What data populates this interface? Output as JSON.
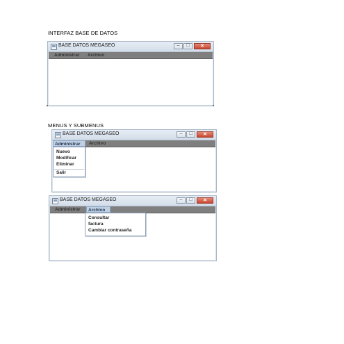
{
  "headings": {
    "interfaz": "INTERFAZ BASE DE DATOS",
    "menus": "MENUS Y SUBMENUS"
  },
  "windows": [
    {
      "title": "BASE DATOS MEGASEO",
      "menu": [
        "Administrar",
        "Archivo"
      ],
      "open_menu": null
    },
    {
      "title": "BASE DATOS MEGASEO",
      "menu": [
        "Administrar",
        "Archivo"
      ],
      "open_menu": "Administrar",
      "dropdown": [
        "Nuevo",
        "Modificar",
        "Eliminar",
        "Salir"
      ]
    },
    {
      "title": "BASE DATOS MEGASEO",
      "menu": [
        "Administrar",
        "Archivo"
      ],
      "open_menu": "Archivo",
      "dropdown": [
        "Consultar",
        "factura",
        "Cambiar contraseña"
      ]
    }
  ],
  "icons": {
    "minimize": "minimize-icon",
    "maximize": "maximize-icon",
    "close": "close-icon",
    "app": "java-app-icon"
  },
  "colors": {
    "menubar": "#7f7f7f",
    "close_button": "#c9452f",
    "active_menu": "#bfcfe4"
  }
}
